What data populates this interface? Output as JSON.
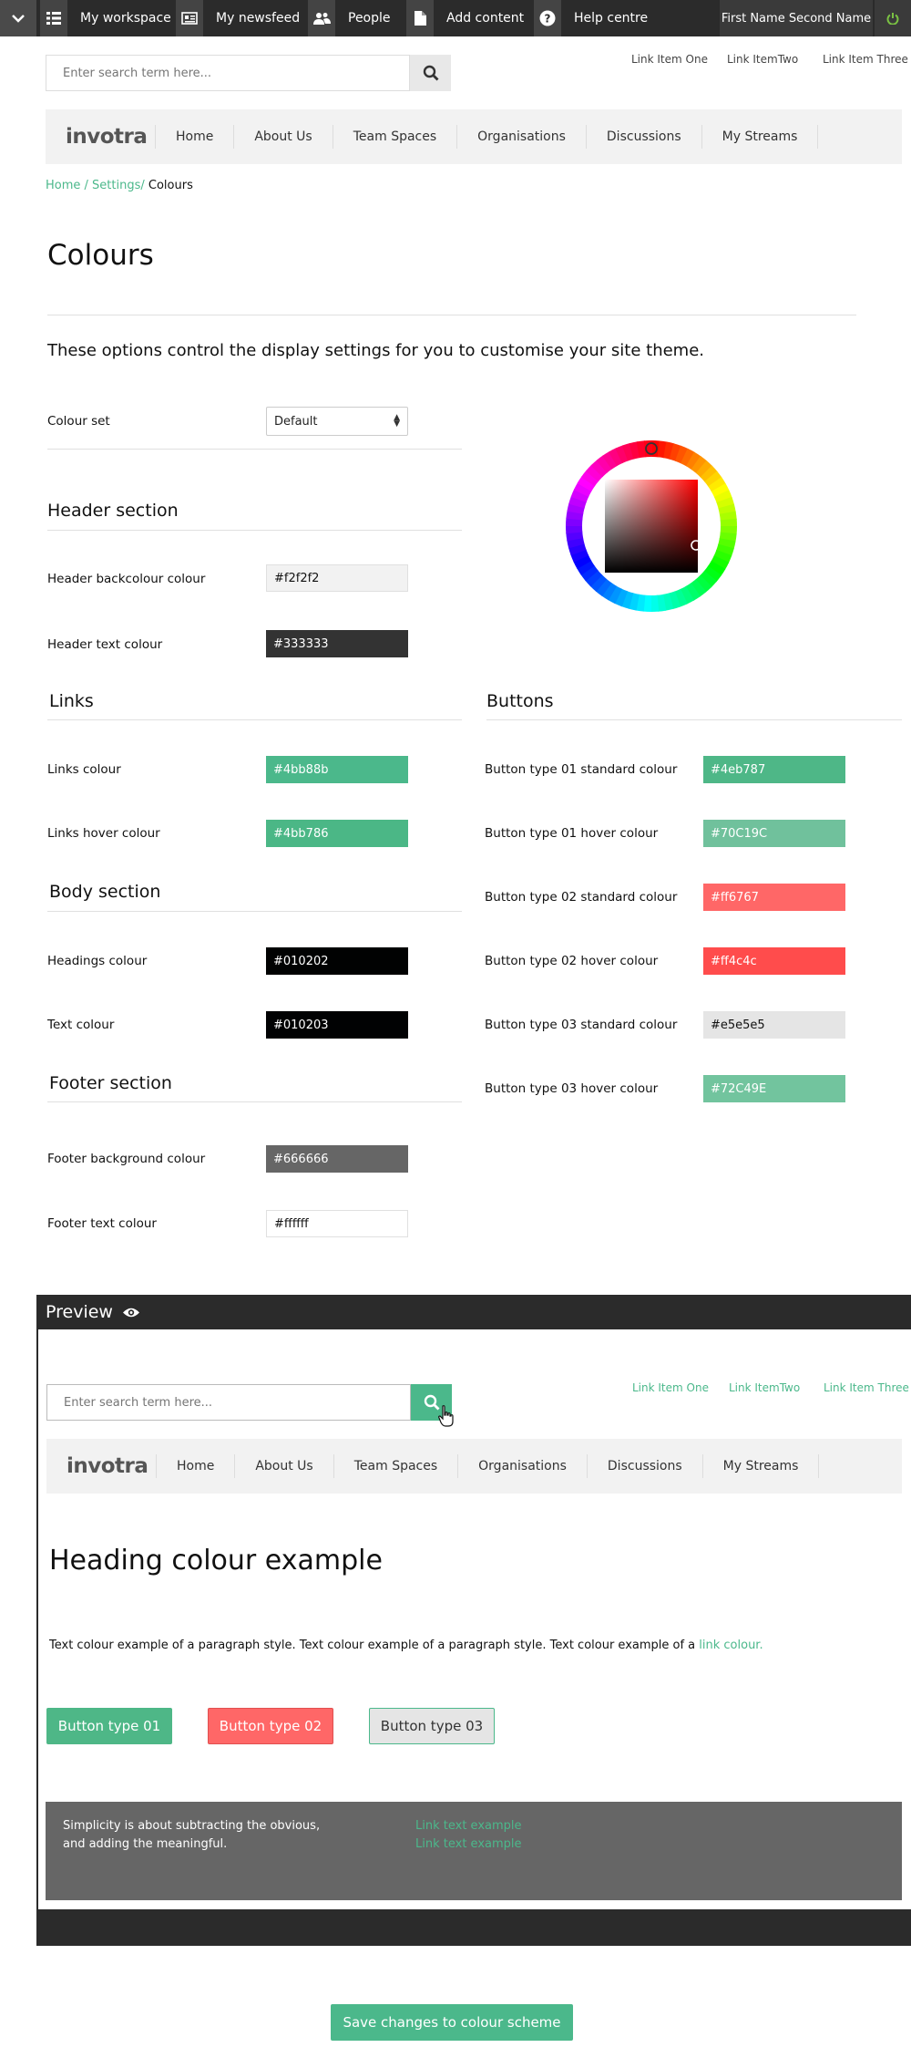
{
  "topbar": {
    "items": [
      "My workspace",
      "My newsfeed",
      "People",
      "Add content",
      "Help centre"
    ],
    "user": "First Name Second Name"
  },
  "search": {
    "placeholder": "Enter search term here..."
  },
  "toplinks": [
    "Link Item One",
    "Link ItemTwo",
    "Link Item Three"
  ],
  "nav": {
    "logo": "invotra",
    "items": [
      "Home",
      "About Us",
      "Team Spaces",
      "Organisations",
      "Discussions",
      "My Streams"
    ]
  },
  "breadcrumb": {
    "home": "Home /",
    "settings": "Settings/",
    "current": " Colours"
  },
  "page": {
    "title": "Colours",
    "intro": "These options control the display settings for you  to customise your site theme."
  },
  "colour_set": {
    "label": "Colour set",
    "value": "Default"
  },
  "header_section": {
    "title": "Header section",
    "backcolour_label": "Header backcolour colour",
    "backcolour": "#f2f2f2",
    "text_label": "Header text colour",
    "text": "#333333"
  },
  "links_section": {
    "title": "Links",
    "colour_label": "Links colour",
    "colour": "#4bb88b",
    "hover_label": "Links hover colour",
    "hover": "#4bb786"
  },
  "body_section": {
    "title": "Body section",
    "headings_label": "Headings colour",
    "headings": "#010202",
    "text_label": "Text colour",
    "text": "#010203"
  },
  "footer_section": {
    "title": "Footer section",
    "bg_label": "Footer background colour",
    "bg": "#666666",
    "text_label": "Footer text colour",
    "text": "#ffffff"
  },
  "buttons_section": {
    "title": "Buttons",
    "items": [
      {
        "label": "Button type 01 standard colour",
        "value": "#4eb787",
        "bg": "#4eb787",
        "fg": "#ffffff"
      },
      {
        "label": "Button type 01 hover colour",
        "value": "#70C19C",
        "bg": "#70c19c",
        "fg": "#ffffff"
      },
      {
        "label": "Button type 02 standard colour",
        "value": "#ff6767",
        "bg": "#ff6767",
        "fg": "#ffffff"
      },
      {
        "label": "Button type 02 hover colour",
        "value": "#ff4c4c",
        "bg": "#ff4c4c",
        "fg": "#ffffff"
      },
      {
        "label": "Button type 03 standard colour",
        "value": "#e5e5e5",
        "bg": "#e5e5e5",
        "fg": "#111111"
      },
      {
        "label": "Button type 03 hover colour",
        "value": "#72C49E",
        "bg": "#72c49e",
        "fg": "#ffffff"
      }
    ]
  },
  "preview": {
    "title": "Preview",
    "heading": "Heading colour example",
    "text": "Text colour example of a paragraph style. Text colour example of a paragraph style. Text colour example of a ",
    "link": "link colour.",
    "buttons": [
      "Button type 01",
      "Button type 02",
      "Button type 03"
    ],
    "footer_quote": "Simplicity is about subtracting the obvious, and adding the meaningful.",
    "footer_links": [
      "Link text example",
      "Link text example"
    ]
  },
  "save_label": "Save changes to colour scheme",
  "colors": {
    "accent": "#4bb88b",
    "dark": "#2b2b2b"
  }
}
